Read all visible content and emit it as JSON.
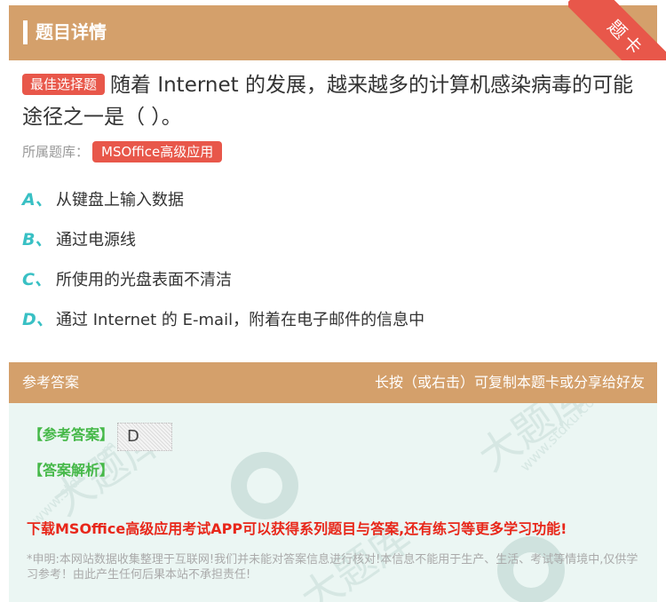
{
  "header": {
    "title": "题目详情",
    "corner_badge": "题卡"
  },
  "question": {
    "tag": "最佳选择题",
    "text": "随着 Internet 的发展，越来越多的计算机感染病毒的可能途径之一是（ ）。",
    "library_label": "所属题库：",
    "library_name": "MSOffice高级应用"
  },
  "options": [
    {
      "letter": "A、",
      "text": "从键盘上输入数据"
    },
    {
      "letter": "B、",
      "text": "通过电源线"
    },
    {
      "letter": "C、",
      "text": "所使用的光盘表面不清洁"
    },
    {
      "letter": "D、",
      "text": "通过 Internet 的 E-mail，附着在电子邮件的信息中"
    }
  ],
  "answer_section": {
    "title": "参考答案",
    "hint": "长按（或右击）可复制本题卡或分享给好友",
    "answer_label": "【参考答案】",
    "answer_value": "D",
    "analysis_label": "【答案解析】",
    "promo": "下载MSOffice高级应用考试APP可以获得系列题目与答案,还有练习等更多学习功能!",
    "disclaimer": "*申明:本网站数据收集整理于互联网!我们并未能对答案信息进行核对!本信息不能用于生产、生活、考试等情境中,仅供学习参考！由此产生任何后果本站不承担责任!"
  },
  "colors": {
    "header_bg": "#d4a06b",
    "accent_red": "#e8574a",
    "option_letter": "#39c0c4",
    "answer_green": "#45b848",
    "promo_red": "#e8271a",
    "answer_bg": "#ebf6f3"
  }
}
